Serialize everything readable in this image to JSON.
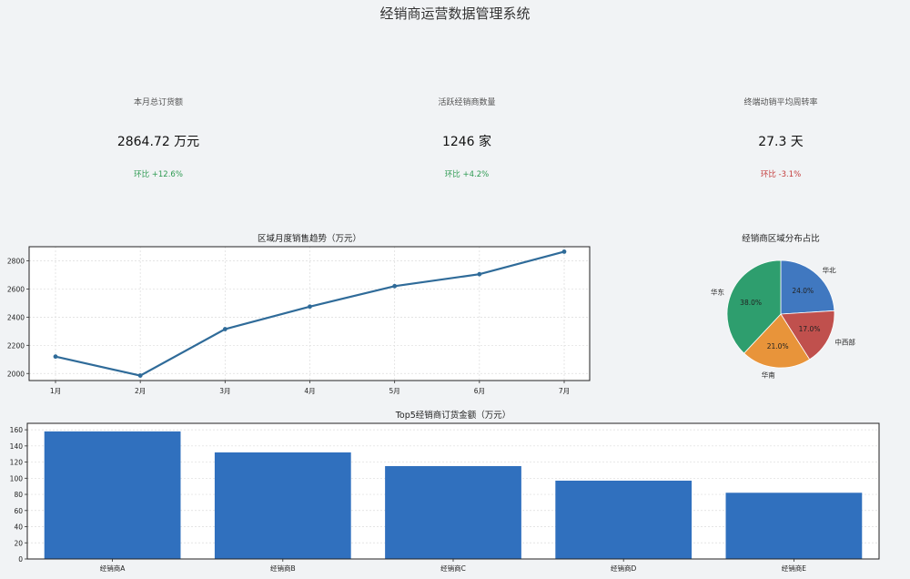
{
  "title": "经销商运营数据管理系统",
  "kpis": [
    {
      "label": "本月总订货额",
      "value": "2864.72 万元",
      "change": "环比 +12.6%",
      "color": "#2e9a52"
    },
    {
      "label": "活跃经销商数量",
      "value": "1246 家",
      "change": "环比 +4.2%",
      "color": "#2e9a52"
    },
    {
      "label": "终端动销平均周转率",
      "value": "27.3 天",
      "change": "环比 -3.1%",
      "color": "#c43c3c"
    }
  ],
  "chart_data": [
    {
      "type": "line",
      "title": "区域月度销售趋势（万元）",
      "categories": [
        "1月",
        "2月",
        "3月",
        "4月",
        "5月",
        "6月",
        "7月"
      ],
      "values": [
        2120,
        1985,
        2315,
        2475,
        2620,
        2705,
        2865
      ],
      "yticks": [
        2000,
        2200,
        2400,
        2600,
        2800
      ],
      "ylim": [
        1950,
        2900
      ],
      "grid": true,
      "color": "#2f6b99"
    },
    {
      "type": "pie",
      "title": "经销商区域分布占比",
      "slices": [
        {
          "label": "华北",
          "value": 24.0,
          "pct_label": "24.0%",
          "color": "#4078c0"
        },
        {
          "label": "中西部",
          "value": 17.0,
          "pct_label": "17.0%",
          "color": "#c0504d"
        },
        {
          "label": "华南",
          "value": 21.0,
          "pct_label": "21.0%",
          "color": "#e8943a"
        },
        {
          "label": "华东",
          "value": 38.0,
          "pct_label": "38.0%",
          "color": "#2e9e6e"
        }
      ]
    },
    {
      "type": "bar",
      "title": "Top5经销商订货金额（万元）",
      "categories": [
        "经销商A",
        "经销商B",
        "经销商C",
        "经销商D",
        "经销商E"
      ],
      "values": [
        158,
        132,
        115,
        97,
        82
      ],
      "yticks": [
        0,
        20,
        40,
        60,
        80,
        100,
        120,
        140,
        160
      ],
      "ylim": [
        0,
        168
      ],
      "grid": true,
      "color": "#3070be"
    }
  ]
}
